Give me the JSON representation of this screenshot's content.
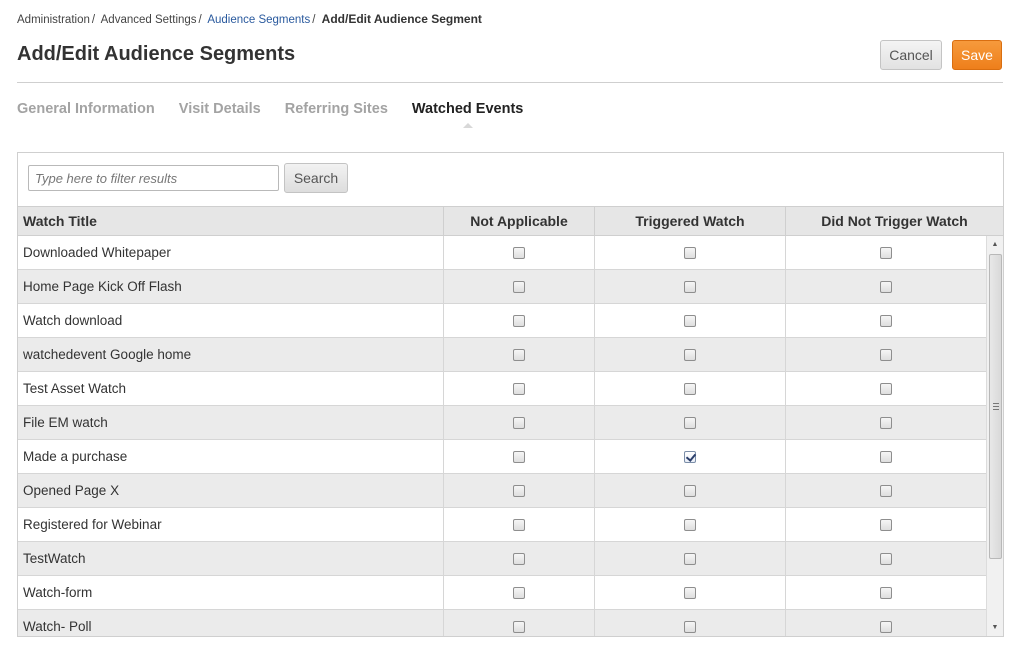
{
  "breadcrumb": {
    "items": [
      {
        "label": "Administration"
      },
      {
        "label": "Advanced Settings"
      },
      {
        "label": "Audience Segments"
      }
    ],
    "separator": "/",
    "current": "Add/Edit Audience Segment"
  },
  "page": {
    "title": "Add/Edit Audience Segments"
  },
  "actions": {
    "cancel_label": "Cancel",
    "save_label": "Save"
  },
  "colors": {
    "accent": "#ef8323",
    "link": "#2a5a9e"
  },
  "tabs": [
    {
      "label": "General Information",
      "active": false
    },
    {
      "label": "Visit Details",
      "active": false
    },
    {
      "label": "Referring Sites",
      "active": false
    },
    {
      "label": "Watched Events",
      "active": true
    }
  ],
  "filter": {
    "placeholder": "Type here to filter results",
    "value": "",
    "search_label": "Search"
  },
  "grid": {
    "columns": [
      "Watch Title",
      "Not Applicable",
      "Triggered Watch",
      "Did Not Trigger Watch"
    ],
    "rows": [
      {
        "title": "Downloaded Whitepaper",
        "not_applicable": false,
        "triggered": false,
        "did_not_trigger": false
      },
      {
        "title": "Home Page Kick Off Flash",
        "not_applicable": false,
        "triggered": false,
        "did_not_trigger": false
      },
      {
        "title": "Watch download",
        "not_applicable": false,
        "triggered": false,
        "did_not_trigger": false
      },
      {
        "title": "watchedevent Google home",
        "not_applicable": false,
        "triggered": false,
        "did_not_trigger": false
      },
      {
        "title": "Test Asset Watch",
        "not_applicable": false,
        "triggered": false,
        "did_not_trigger": false
      },
      {
        "title": "File EM watch",
        "not_applicable": false,
        "triggered": false,
        "did_not_trigger": false
      },
      {
        "title": "Made a purchase",
        "not_applicable": false,
        "triggered": true,
        "did_not_trigger": false
      },
      {
        "title": "Opened Page X",
        "not_applicable": false,
        "triggered": false,
        "did_not_trigger": false
      },
      {
        "title": "Registered for Webinar",
        "not_applicable": false,
        "triggered": false,
        "did_not_trigger": false
      },
      {
        "title": "TestWatch",
        "not_applicable": false,
        "triggered": false,
        "did_not_trigger": false
      },
      {
        "title": "Watch-form",
        "not_applicable": false,
        "triggered": false,
        "did_not_trigger": false
      },
      {
        "title": "Watch- Poll",
        "not_applicable": false,
        "triggered": false,
        "did_not_trigger": false
      }
    ]
  },
  "scrollbar": {
    "up_icon": "triangle-up-icon",
    "down_icon": "triangle-down-icon",
    "grip_icon": "grip-icon"
  }
}
